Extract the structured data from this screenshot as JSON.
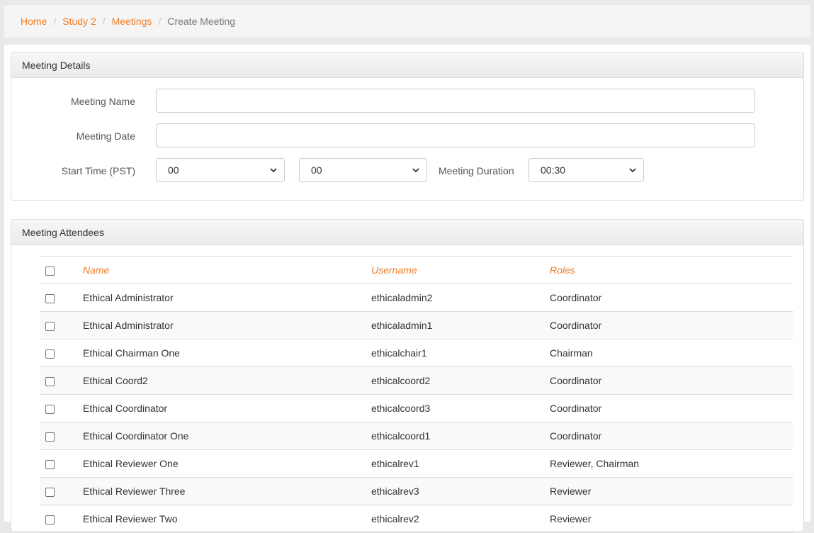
{
  "breadcrumb": {
    "items": [
      "Home",
      "Study 2",
      "Meetings"
    ],
    "current": "Create Meeting"
  },
  "details": {
    "title": "Meeting Details",
    "meeting_name_label": "Meeting Name",
    "meeting_name_value": "",
    "meeting_date_label": "Meeting Date",
    "meeting_date_value": "",
    "start_time_label": "Start Time (PST)",
    "start_hour": "00",
    "start_minute": "00",
    "duration_label": "Meeting Duration",
    "duration_value": "00:30"
  },
  "attendees": {
    "title": "Meeting Attendees",
    "columns": [
      "Name",
      "Username",
      "Roles"
    ],
    "rows": [
      {
        "name": "Ethical Administrator",
        "username": "ethicaladmin2",
        "roles": "Coordinator"
      },
      {
        "name": "Ethical Administrator",
        "username": "ethicaladmin1",
        "roles": "Coordinator"
      },
      {
        "name": "Ethical Chairman One",
        "username": "ethicalchair1",
        "roles": "Chairman"
      },
      {
        "name": "Ethical Coord2",
        "username": "ethicalcoord2",
        "roles": "Coordinator"
      },
      {
        "name": "Ethical Coordinator",
        "username": "ethicalcoord3",
        "roles": "Coordinator"
      },
      {
        "name": "Ethical Coordinator One",
        "username": "ethicalcoord1",
        "roles": "Coordinator"
      },
      {
        "name": "Ethical Reviewer One",
        "username": "ethicalrev1",
        "roles": "Reviewer, Chairman"
      },
      {
        "name": "Ethical Reviewer Three",
        "username": "ethicalrev3",
        "roles": "Reviewer"
      },
      {
        "name": "Ethical Reviewer Two",
        "username": "ethicalrev2",
        "roles": "Reviewer"
      }
    ]
  },
  "colors": {
    "accent": "#f07e26",
    "border": "#dddddd"
  }
}
